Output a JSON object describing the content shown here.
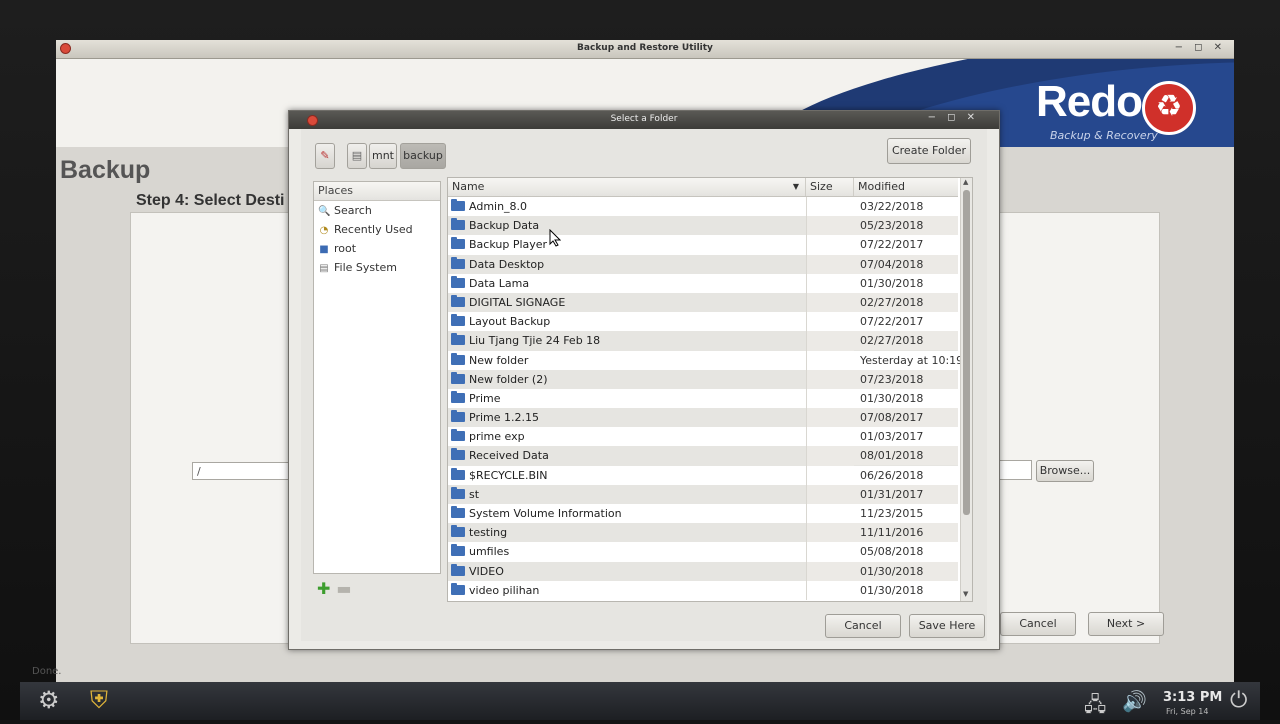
{
  "app": {
    "title": "Backup and Restore Utility",
    "logo_text": "Redo",
    "logo_sub": "Backup & Recovery",
    "section_title": "Backup",
    "step_title": "Step 4: Select Desti",
    "dest_path": "/",
    "browse_label": "Browse...",
    "cancel_label": "Cancel",
    "next_label": "Next >",
    "status": "Done."
  },
  "dialog": {
    "title": "Select a Folder",
    "path_buttons": [
      "mnt",
      "backup"
    ],
    "create_folder_label": "Create Folder",
    "places_header": "Places",
    "places": [
      {
        "icon": "search-icon",
        "glyph": "🔍",
        "label": "Search"
      },
      {
        "icon": "recent-icon",
        "glyph": "◔",
        "label": "Recently Used"
      },
      {
        "icon": "home-folder-icon",
        "glyph": "■",
        "label": "root"
      },
      {
        "icon": "drive-icon",
        "glyph": "▤",
        "label": "File System"
      }
    ],
    "columns": {
      "name": "Name",
      "size": "Size",
      "modified": "Modified"
    },
    "files": [
      {
        "name": "Admin_8.0",
        "modified": "03/22/2018"
      },
      {
        "name": "Backup Data",
        "modified": "05/23/2018"
      },
      {
        "name": "Backup Player",
        "modified": "07/22/2017"
      },
      {
        "name": "Data Desktop",
        "modified": "07/04/2018"
      },
      {
        "name": "Data Lama",
        "modified": "01/30/2018"
      },
      {
        "name": "DIGITAL SIGNAGE",
        "modified": "02/27/2018"
      },
      {
        "name": "Layout Backup",
        "modified": "07/22/2017"
      },
      {
        "name": "Liu Tjang Tjie 24 Feb 18",
        "modified": "02/27/2018"
      },
      {
        "name": "New folder",
        "modified": "Yesterday at 10:19"
      },
      {
        "name": "New folder (2)",
        "modified": "07/23/2018"
      },
      {
        "name": "Prime",
        "modified": "01/30/2018"
      },
      {
        "name": "Prime 1.2.15",
        "modified": "07/08/2017"
      },
      {
        "name": "prime exp",
        "modified": "01/03/2017"
      },
      {
        "name": "Received Data",
        "modified": "08/01/2018"
      },
      {
        "name": "$RECYCLE.BIN",
        "modified": "06/26/2018"
      },
      {
        "name": "st",
        "modified": "01/31/2017"
      },
      {
        "name": "System Volume Information",
        "modified": "11/23/2015"
      },
      {
        "name": "testing",
        "modified": "11/11/2016"
      },
      {
        "name": "umfiles",
        "modified": "05/08/2018"
      },
      {
        "name": "VIDEO",
        "modified": "01/30/2018"
      },
      {
        "name": "video pilihan",
        "modified": "01/30/2018"
      }
    ],
    "cancel_label": "Cancel",
    "save_label": "Save Here"
  },
  "taskbar": {
    "time": "3:13 PM",
    "date": "Fri, Sep 14"
  }
}
